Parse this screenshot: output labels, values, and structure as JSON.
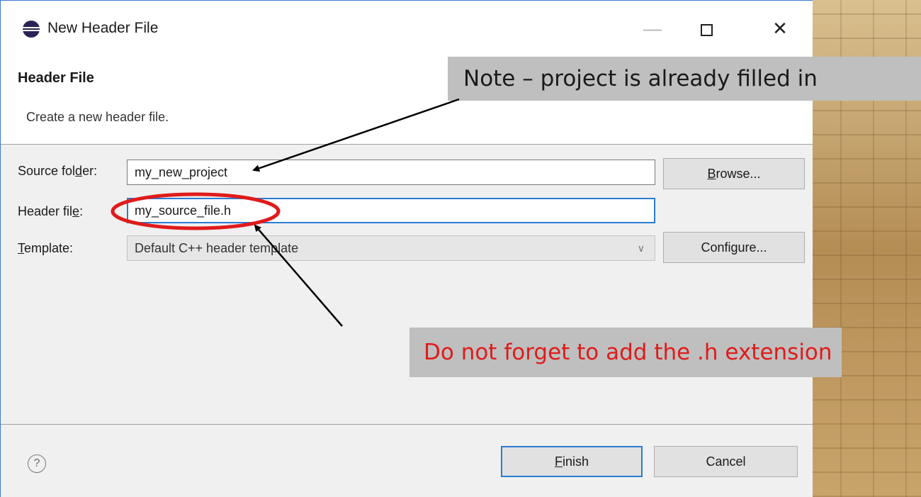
{
  "window": {
    "title": "New Header File",
    "minimize_glyph": "—",
    "close_glyph": "✕"
  },
  "header": {
    "title": "Header File",
    "description": "Create a new header file."
  },
  "form": {
    "source_folder": {
      "label_pre": "Source fol",
      "label_mnemonic": "d",
      "label_post": "er:",
      "value": "my_new_project",
      "button_pre": "",
      "button_mnemonic": "B",
      "button_post": "rowse..."
    },
    "header_file": {
      "label_pre": "Header fil",
      "label_mnemonic": "e",
      "label_post": ":",
      "value": "my_source_file.h"
    },
    "template": {
      "label_pre": "",
      "label_mnemonic": "T",
      "label_post": "emplate:",
      "selected": "Default C++ header template",
      "button_label": "Configure..."
    }
  },
  "footer": {
    "help_glyph": "?",
    "finish_pre": "",
    "finish_mnemonic": "F",
    "finish_post": "inish",
    "cancel_label": "Cancel"
  },
  "annotations": {
    "note_project": "Note – project is already filled in",
    "note_extension": "Do not forget to add the .h extension",
    "note_extension_color": "#e01b1b",
    "circle_color": "#e01b1b"
  },
  "colors": {
    "focus_border": "#2b7cd3",
    "callout_bg": "#bfbfbf"
  }
}
